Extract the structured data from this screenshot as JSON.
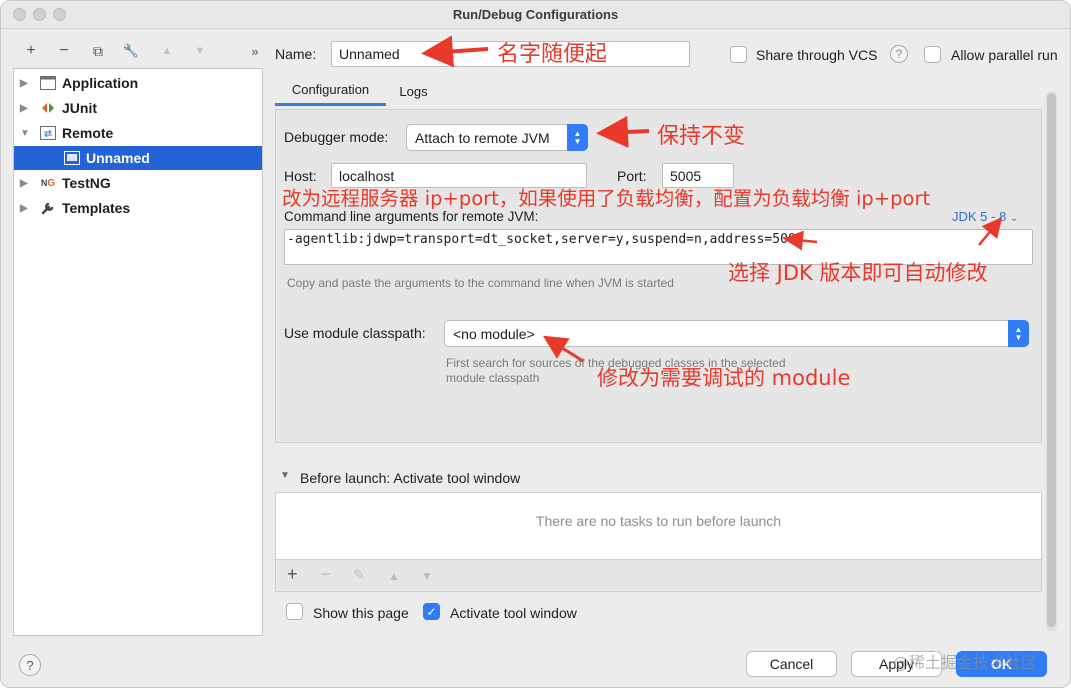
{
  "window": {
    "title": "Run/Debug Configurations"
  },
  "toolbar": {
    "add": "+",
    "remove": "−",
    "copy": "⧉",
    "wrench": "🔧",
    "up": "▲",
    "down": "▼",
    "more": "»"
  },
  "tree": {
    "items": [
      {
        "label": "Application",
        "icon": "application-icon",
        "expand": "▶"
      },
      {
        "label": "JUnit",
        "icon": "junit-icon",
        "expand": "▶"
      },
      {
        "label": "Remote",
        "icon": "remote-icon",
        "expand": "▼"
      },
      {
        "label": "Unnamed",
        "icon": "remote-config-icon",
        "expand": ""
      },
      {
        "label": "TestNG",
        "icon": "testng-icon",
        "expand": "▶"
      },
      {
        "label": "Templates",
        "icon": "wrench-icon",
        "expand": "▶"
      }
    ]
  },
  "name_field": {
    "label": "Name:",
    "value": "Unnamed"
  },
  "share_vcs": {
    "label": "Share through VCS",
    "checked": false
  },
  "parallel_run": {
    "label": "Allow parallel run",
    "checked": false
  },
  "tabs": [
    {
      "label": "Configuration",
      "active": true
    },
    {
      "label": "Logs",
      "active": false
    }
  ],
  "debugger_mode": {
    "label": "Debugger mode:",
    "value": "Attach to remote JVM"
  },
  "host": {
    "label": "Host:",
    "value": "localhost"
  },
  "port": {
    "label": "Port:",
    "value": "5005"
  },
  "cmd_args": {
    "label": "Command line arguments for remote JVM:",
    "jdk_link": "JDK 5 - 8",
    "value": "-agentlib:jdwp=transport=dt_socket,server=y,suspend=n,address=5005",
    "hint": "Copy and paste the arguments to the command line when JVM is started"
  },
  "module_classpath": {
    "label": "Use module classpath:",
    "value": "<no module>",
    "hint_line1": "First search for sources of the debugged classes in the selected",
    "hint_line2": "module classpath"
  },
  "before_launch": {
    "title": "Before launch: Activate tool window",
    "empty_text": "There are no tasks to run before launch"
  },
  "options": {
    "show_page": {
      "label": "Show this page",
      "checked": false
    },
    "activate_tool": {
      "label": "Activate tool window",
      "checked": true
    }
  },
  "buttons": {
    "help": "?",
    "cancel": "Cancel",
    "apply": "Apply",
    "ok": "OK"
  },
  "annotations": {
    "name_note": "名字随便起",
    "mode_note": "保持不变",
    "host_note": "改为远程服务器 ip+port，如果使用了负载均衡，配置为负载均衡 ip+port",
    "jdk_note": "选择 JDK 版本即可自动修改",
    "module_note": "修改为需要调试的 module"
  },
  "watermark": "@稀土掘金技术社区",
  "colors": {
    "accent": "#2f7cf6",
    "selection": "#2463d6",
    "annotation": "#e8392a"
  }
}
